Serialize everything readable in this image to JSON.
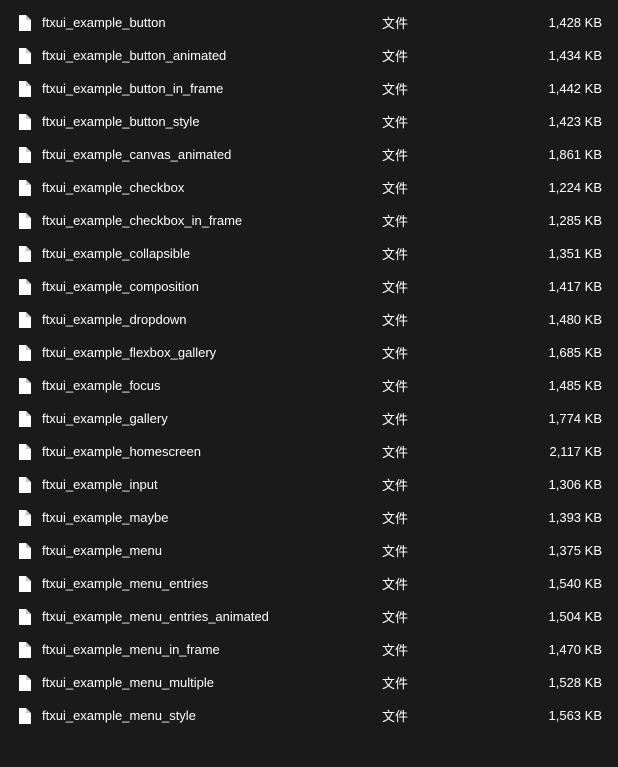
{
  "files": [
    {
      "name": "ftxui_example_button",
      "type": "文件",
      "size": "1,428 KB"
    },
    {
      "name": "ftxui_example_button_animated",
      "type": "文件",
      "size": "1,434 KB"
    },
    {
      "name": "ftxui_example_button_in_frame",
      "type": "文件",
      "size": "1,442 KB"
    },
    {
      "name": "ftxui_example_button_style",
      "type": "文件",
      "size": "1,423 KB"
    },
    {
      "name": "ftxui_example_canvas_animated",
      "type": "文件",
      "size": "1,861 KB"
    },
    {
      "name": "ftxui_example_checkbox",
      "type": "文件",
      "size": "1,224 KB"
    },
    {
      "name": "ftxui_example_checkbox_in_frame",
      "type": "文件",
      "size": "1,285 KB"
    },
    {
      "name": "ftxui_example_collapsible",
      "type": "文件",
      "size": "1,351 KB"
    },
    {
      "name": "ftxui_example_composition",
      "type": "文件",
      "size": "1,417 KB"
    },
    {
      "name": "ftxui_example_dropdown",
      "type": "文件",
      "size": "1,480 KB"
    },
    {
      "name": "ftxui_example_flexbox_gallery",
      "type": "文件",
      "size": "1,685 KB"
    },
    {
      "name": "ftxui_example_focus",
      "type": "文件",
      "size": "1,485 KB"
    },
    {
      "name": "ftxui_example_gallery",
      "type": "文件",
      "size": "1,774 KB"
    },
    {
      "name": "ftxui_example_homescreen",
      "type": "文件",
      "size": "2,117 KB"
    },
    {
      "name": "ftxui_example_input",
      "type": "文件",
      "size": "1,306 KB"
    },
    {
      "name": "ftxui_example_maybe",
      "type": "文件",
      "size": "1,393 KB"
    },
    {
      "name": "ftxui_example_menu",
      "type": "文件",
      "size": "1,375 KB"
    },
    {
      "name": "ftxui_example_menu_entries",
      "type": "文件",
      "size": "1,540 KB"
    },
    {
      "name": "ftxui_example_menu_entries_animated",
      "type": "文件",
      "size": "1,504 KB"
    },
    {
      "name": "ftxui_example_menu_in_frame",
      "type": "文件",
      "size": "1,470 KB"
    },
    {
      "name": "ftxui_example_menu_multiple",
      "type": "文件",
      "size": "1,528 KB"
    },
    {
      "name": "ftxui_example_menu_style",
      "type": "文件",
      "size": "1,563 KB"
    }
  ]
}
